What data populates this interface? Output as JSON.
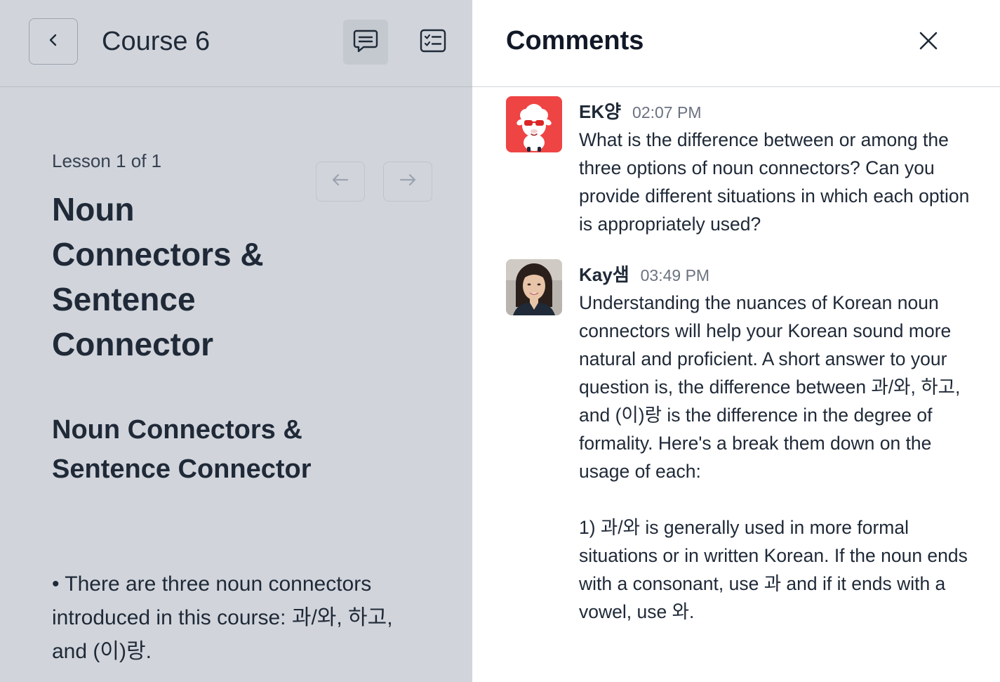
{
  "header": {
    "course_title": "Course 6",
    "icons": [
      "chevron-left-icon",
      "comments-icon",
      "checklist-icon"
    ]
  },
  "lesson": {
    "count_label": "Lesson 1 of 1",
    "title": "Noun Connectors & Sentence Connector",
    "section_heading": "Noun Connectors & Sentence Connector",
    "bullet_text": "• There are three noun connectors introduced in this course: 과/와, 하고, and (이)랑."
  },
  "comments_panel": {
    "title": "Comments",
    "comments": [
      {
        "author": "EK양",
        "time": "02:07 PM",
        "text": "What is the difference between or among the three options of noun connectors? Can you provide different situations in which each option is appropriately used?"
      },
      {
        "author": "Kay샘",
        "time": "03:49 PM",
        "text": "Understanding the nuances of Korean noun connectors will help your Korean sound more natural and proficient. A short answer to your question is, the difference between 과/와, 하고, and (이)랑 is the difference in the degree of formality. Here's a break them down on the usage of each:\n\n1) 과/와 is generally used in more formal situations or in written Korean. If the noun ends with a consonant, use 과 and if it ends with a vowel, use 와."
      }
    ]
  },
  "colors": {
    "left_panel_bg": "#d1d5db",
    "right_panel_bg": "#ffffff",
    "text_primary": "#1f2937",
    "text_muted": "#6b7280",
    "avatar_bg_red": "#ef4444"
  }
}
